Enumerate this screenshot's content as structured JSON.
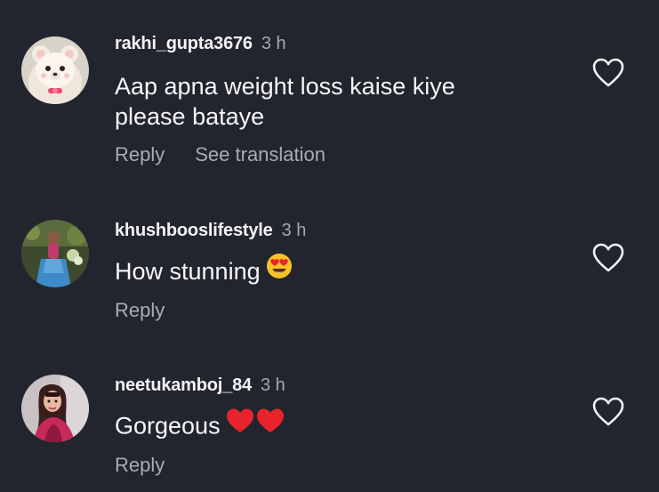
{
  "comments": [
    {
      "username": "rakhi_gupta3676",
      "time": "3 h",
      "text_line1": "Aap apna weight loss kaise kiye",
      "text_line2": "please bataye",
      "reply_label": "Reply",
      "translate_label": "See translation",
      "avatar_icon": "teddy-bear-avatar",
      "like_icon": "heart-outline-icon"
    },
    {
      "username": "khushbooslifestyle",
      "time": "3 h",
      "text": "How stunning",
      "emoji": "heart-eyes-emoji",
      "reply_label": "Reply",
      "avatar_icon": "profile-photo-avatar",
      "like_icon": "heart-outline-icon"
    },
    {
      "username": "neetukamboj_84",
      "time": "3 h",
      "text": "Gorgeous",
      "emoji": "two-red-hearts-emoji",
      "reply_label": "Reply",
      "avatar_icon": "profile-photo-avatar",
      "like_icon": "heart-outline-icon"
    }
  ],
  "colors": {
    "background": "#23252e",
    "username": "#f3f3f5",
    "secondary_text": "#a9abb3",
    "heart_red": "#e8232b",
    "emoji_yellow": "#f7c324"
  }
}
